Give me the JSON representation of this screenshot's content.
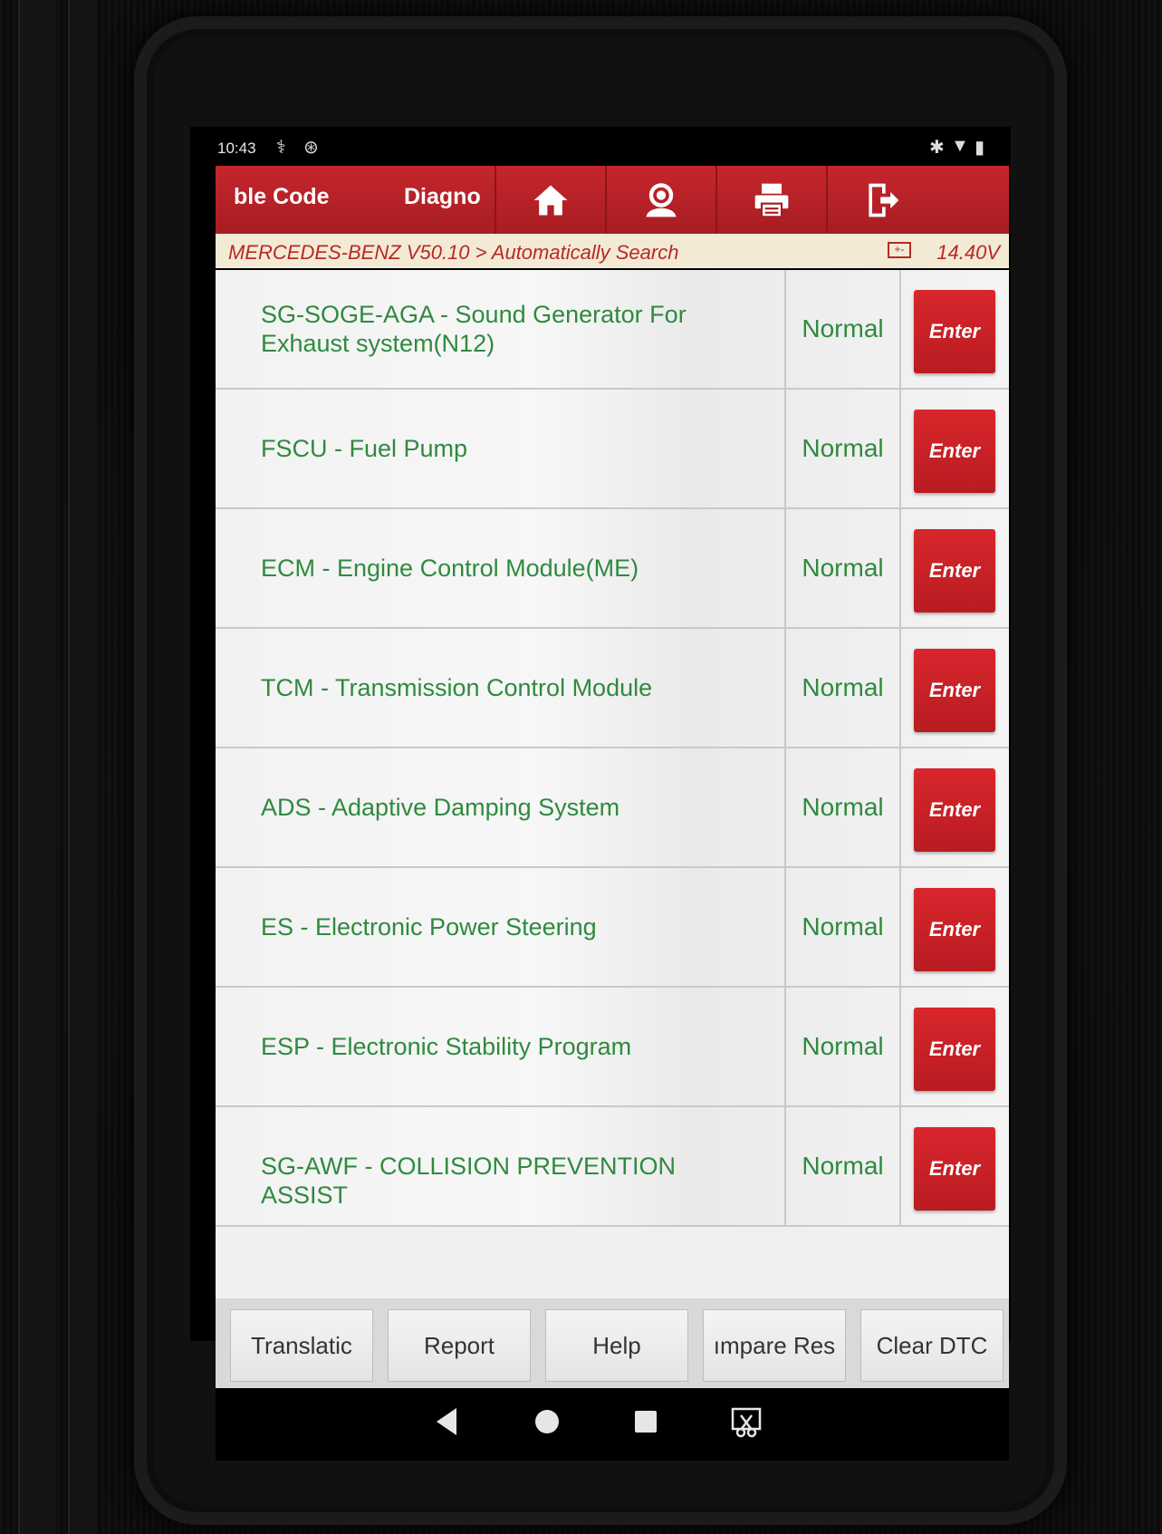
{
  "status_bar": {
    "time": "10:43"
  },
  "toolbar": {
    "tab1": "ble Code",
    "tab2": "Diagno",
    "buttons": [
      "home-icon",
      "user-icon",
      "printer-icon",
      "exit-icon"
    ]
  },
  "breadcrumb": {
    "path": "MERCEDES-BENZ V50.10 > Automatically Search",
    "voltage": "14.40V"
  },
  "systems": [
    {
      "name": "SG-SOGE-AGA - Sound Generator For Exhaust system(N12)",
      "status": "Normal",
      "button": "Enter"
    },
    {
      "name": "FSCU - Fuel Pump",
      "status": "Normal",
      "button": "Enter"
    },
    {
      "name": "ECM - Engine Control Module(ME)",
      "status": "Normal",
      "button": "Enter"
    },
    {
      "name": "TCM - Transmission Control Module",
      "status": "Normal",
      "button": "Enter"
    },
    {
      "name": "ADS - Adaptive Damping System",
      "status": "Normal",
      "button": "Enter"
    },
    {
      "name": "ES - Electronic Power Steering",
      "status": "Normal",
      "button": "Enter"
    },
    {
      "name": "ESP - Electronic Stability Program",
      "status": "Normal",
      "button": "Enter"
    },
    {
      "name": "SG-AWF - COLLISION PREVENTION ASSIST",
      "status": "Normal",
      "button": "Enter"
    }
  ],
  "bottom_buttons": [
    "Translatic",
    "Report",
    "Help",
    "ımpare Res",
    "Clear DTC"
  ],
  "colors": {
    "accent_red": "#c5262c",
    "status_green": "#2f8a3f",
    "breadcrumb_text": "#b72a22"
  }
}
